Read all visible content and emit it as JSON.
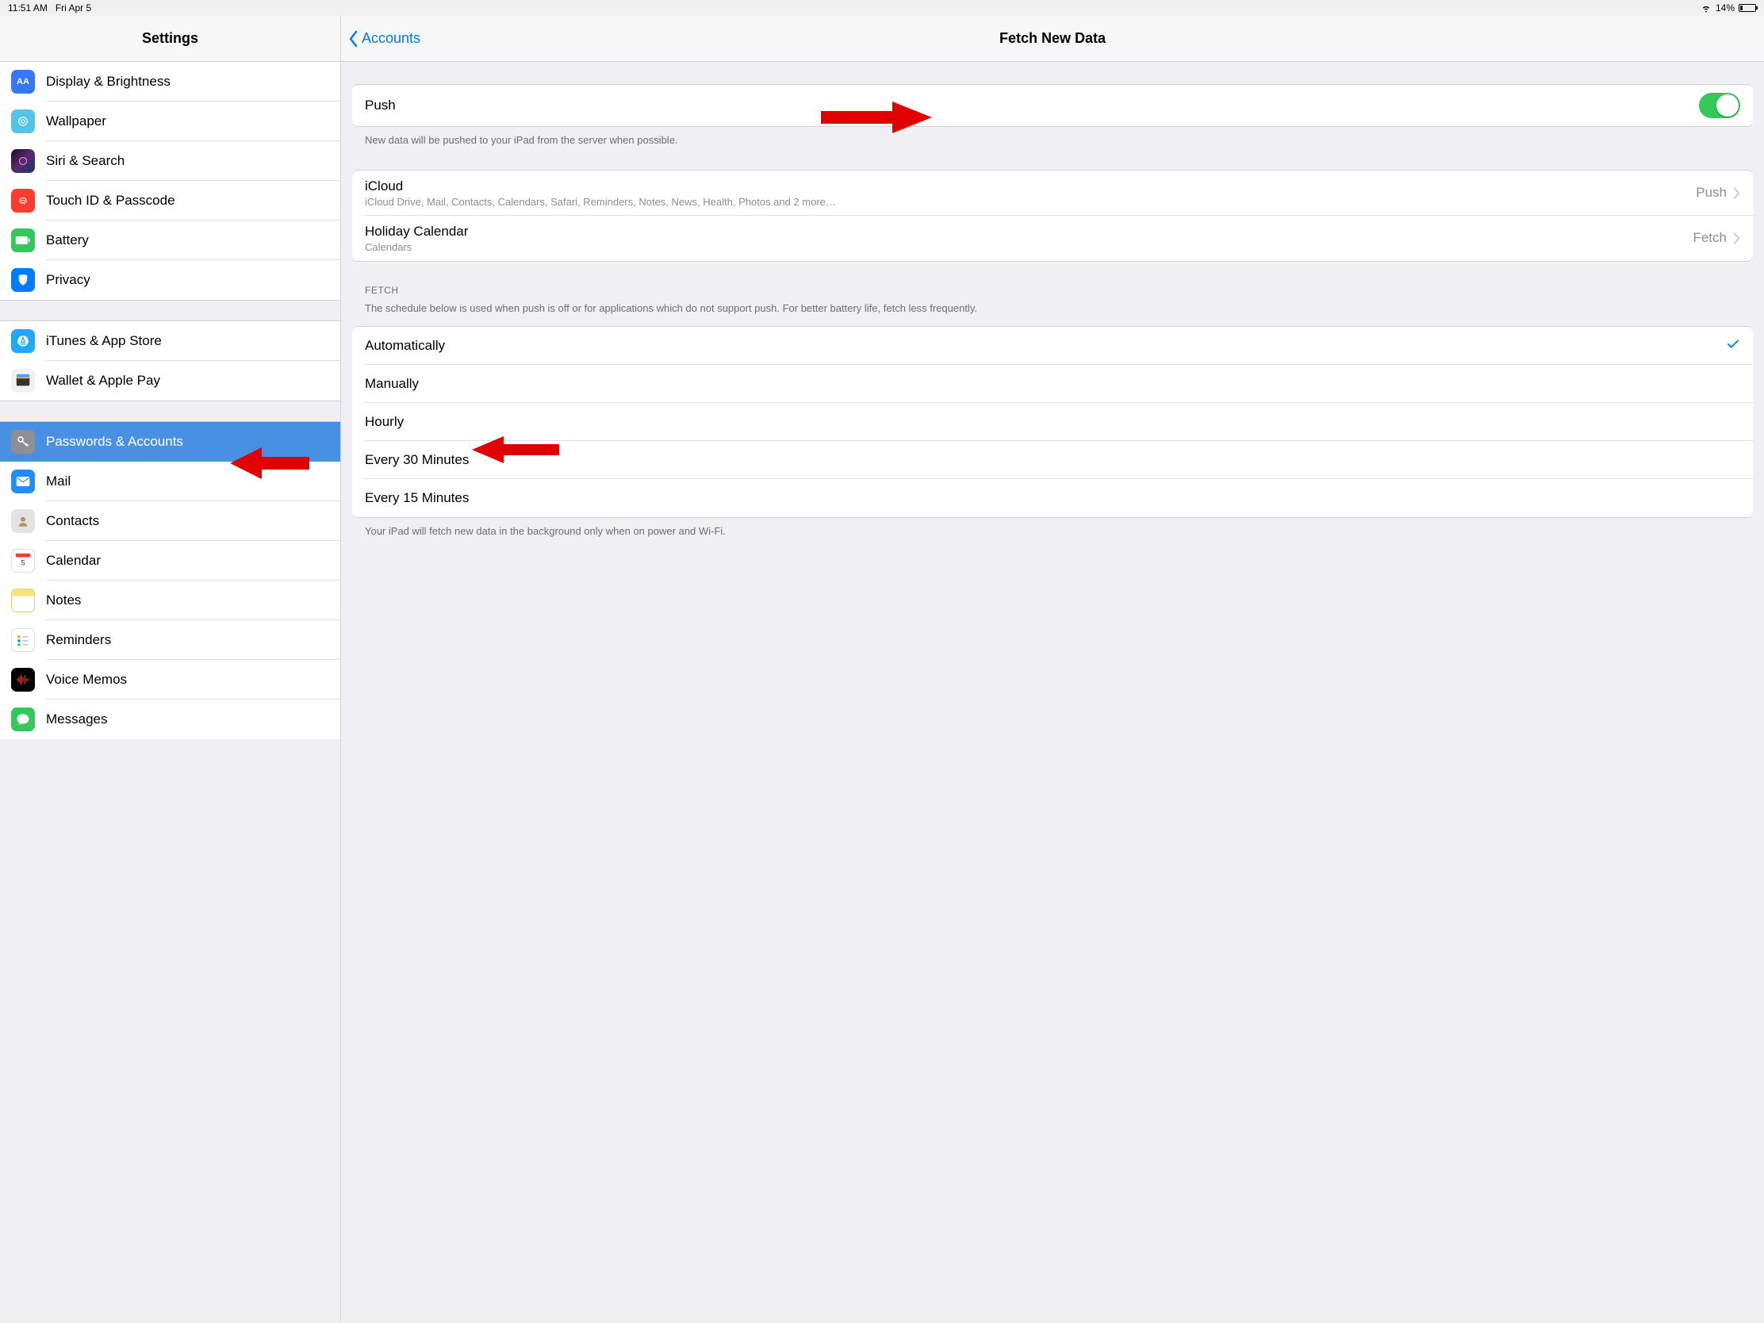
{
  "statusbar": {
    "time": "11:51 AM",
    "date": "Fri Apr 5",
    "battery_pct": "14%"
  },
  "sidebar": {
    "title": "Settings",
    "groups": [
      {
        "items": [
          {
            "label": "Display & Brightness"
          },
          {
            "label": "Wallpaper"
          },
          {
            "label": "Siri & Search"
          },
          {
            "label": "Touch ID & Passcode"
          },
          {
            "label": "Battery"
          },
          {
            "label": "Privacy"
          }
        ]
      },
      {
        "items": [
          {
            "label": "iTunes & App Store"
          },
          {
            "label": "Wallet & Apple Pay"
          }
        ]
      },
      {
        "items": [
          {
            "label": "Passwords & Accounts",
            "selected": true
          },
          {
            "label": "Mail"
          },
          {
            "label": "Contacts"
          },
          {
            "label": "Calendar"
          },
          {
            "label": "Notes"
          },
          {
            "label": "Reminders"
          },
          {
            "label": "Voice Memos"
          },
          {
            "label": "Messages"
          }
        ]
      }
    ]
  },
  "detail": {
    "back_label": "Accounts",
    "title": "Fetch New Data",
    "push": {
      "label": "Push",
      "on": true,
      "footer": "New data will be pushed to your iPad from the server when possible."
    },
    "accounts": [
      {
        "name": "iCloud",
        "sub": "iCloud Drive, Mail, Contacts, Calendars, Safari, Reminders, Notes, News, Health, Photos and 2 more…",
        "mode": "Push"
      },
      {
        "name": "Holiday Calendar",
        "sub": "Calendars",
        "mode": "Fetch"
      }
    ],
    "fetch": {
      "header": "FETCH",
      "header_sub": "The schedule below is used when push is off or for applications which do not support push. For better battery life, fetch less frequently.",
      "options": [
        {
          "label": "Automatically",
          "checked": true
        },
        {
          "label": "Manually"
        },
        {
          "label": "Hourly"
        },
        {
          "label": "Every 30 Minutes"
        },
        {
          "label": "Every 15 Minutes"
        }
      ],
      "footer": "Your iPad will fetch new data in the background only when on power and Wi-Fi."
    }
  }
}
